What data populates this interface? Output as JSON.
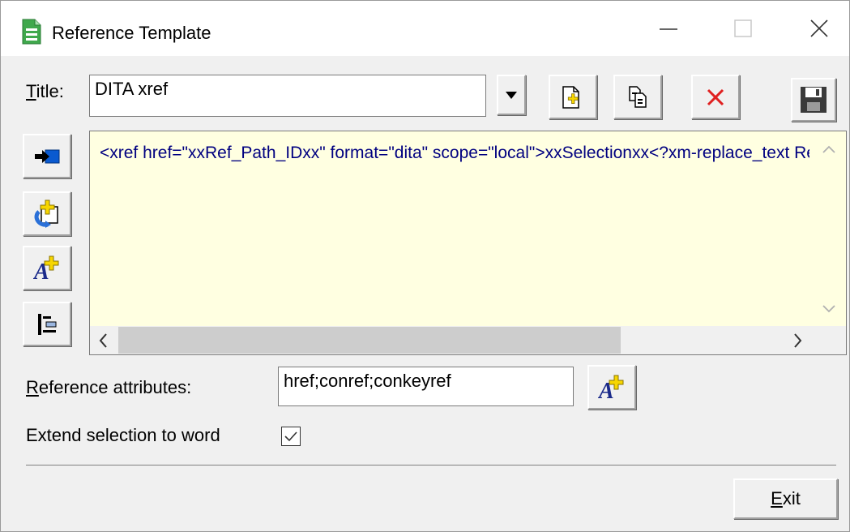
{
  "window": {
    "title": "Reference Template",
    "icon": "document-sheet-icon",
    "controls": [
      "minimize",
      "maximize",
      "close"
    ]
  },
  "title_row": {
    "label_mnemonic": "T",
    "label_rest": "itle:",
    "value": "DITA xref",
    "buttons": [
      {
        "name": "dropdown-button",
        "icon": "triangle-down-icon"
      },
      {
        "name": "new-template-button",
        "icon": "new-page-icon"
      },
      {
        "name": "copy-template-button",
        "icon": "copy-pages-icon"
      },
      {
        "name": "delete-template-button",
        "icon": "red-x-icon"
      },
      {
        "name": "save-template-button",
        "icon": "floppy-disk-icon"
      }
    ]
  },
  "side_tools": [
    {
      "name": "insert-button",
      "icon": "arrow-into-box-icon"
    },
    {
      "name": "insert-reference-button",
      "icon": "rotate-plus-icon"
    },
    {
      "name": "add-attribute-button",
      "icon": "text-a-plus-icon"
    },
    {
      "name": "indent-button",
      "icon": "indent-icon"
    }
  ],
  "editor": {
    "content": "<xref href=\"xxRef_Path_IDxx\" format=\"dita\" scope=\"local\">xxSelectionxx<?xm-replace_text Reference?></xref>",
    "background": "#ffffe1",
    "text_color": "#000080"
  },
  "reference_attributes": {
    "label_mnemonic": "R",
    "label_rest": "eference attributes:",
    "value": "href;conref;conkeyref",
    "add_button_icon": "text-a-plus-icon"
  },
  "extend_selection": {
    "label": "Extend selection to word",
    "checked": true
  },
  "exit_button": {
    "mnemonic": "E",
    "rest": "xit"
  }
}
